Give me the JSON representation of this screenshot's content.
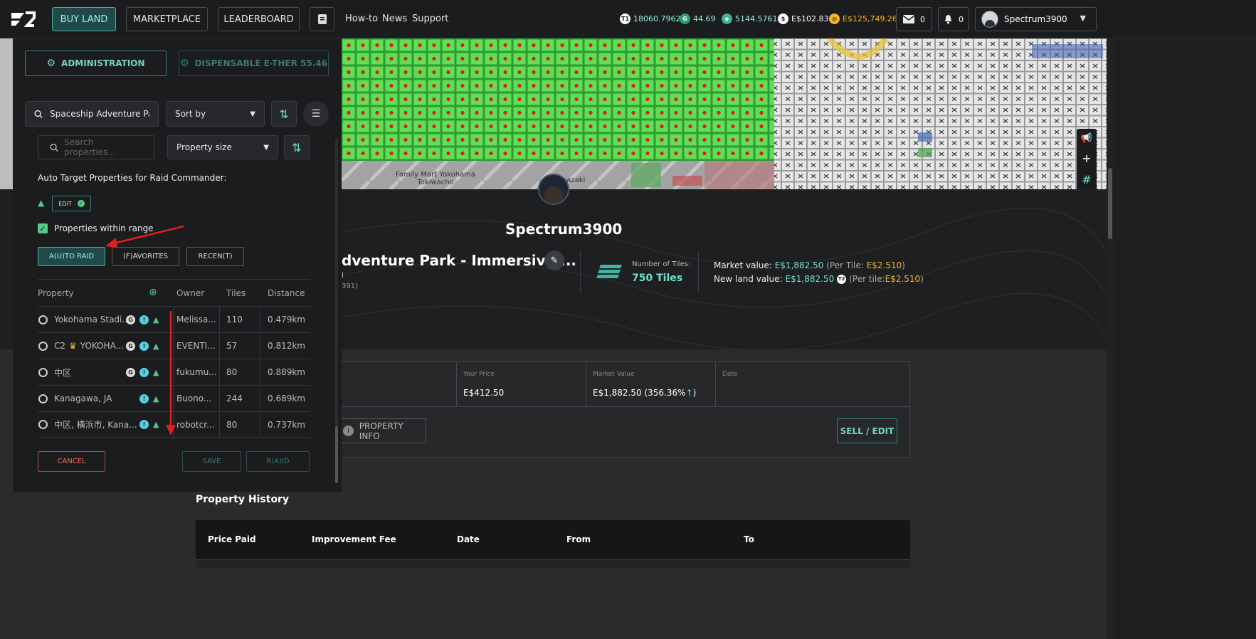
{
  "nav": {
    "buy_land": "BUY LAND",
    "marketplace": "MARKETPLACE",
    "leaderboard": "LEADERBOARD",
    "howto": "How-to",
    "news": "News",
    "support": "Support",
    "stats": {
      "t1": "18060.7962",
      "gem": "44.69",
      "essence": "5144.5761",
      "dollar": "E$102.83",
      "gold": "E$125,749.26"
    },
    "mail_count": "0",
    "notif_count": "0",
    "username": "Spectrum3900"
  },
  "map": {
    "label_familymart": "Family Mart Yokohama\nTokiwacho",
    "label_partial": "nazaki"
  },
  "profile": {
    "name": "Spectrum3900",
    "property_title": "dventure Park - Immersive ...",
    "subtitle_partial": "i",
    "id_partial": "391)",
    "tiles_label": "Number of Tiles:",
    "tiles_value": "750 Tiles",
    "market_value_label": "Market value:",
    "market_value": "E$1,882.50",
    "market_per_tile_prefix": "(Per Tile: ",
    "market_per_tile": "E$2.510",
    "new_land_label": "New land value:",
    "new_land_value": "E$1,882.50",
    "new_land_per_tile_prefix": "(Per tile: ",
    "new_land_per_tile": "E$2.510"
  },
  "details": {
    "your_price_label": "Your Price",
    "your_price": "E$412.50",
    "market_value_label": "Market Value",
    "market_value": "E$1,882.50 (356.36%",
    "date_label": "Date",
    "property_info": "PROPERTY INFO",
    "sell_edit": "SELL / EDIT"
  },
  "history": {
    "title": "Property History",
    "columns": [
      "Price Paid",
      "Improvement Fee",
      "Date",
      "From",
      "To"
    ]
  },
  "panel": {
    "administration": "ADMINISTRATION",
    "dispensable": "DISPENSABLE E-THER 55.46",
    "search_value": "Spaceship Adventure Par",
    "sort_by": "Sort by",
    "search_placeholder": "Search properties...",
    "property_size": "Property size",
    "auto_target_label": "Auto Target Properties for Raid Commander:",
    "edit": "EDIT",
    "within_range": "Properties within range",
    "tab_auto": "A(U)TO RAID",
    "tab_fav": "(F)AVORITES",
    "tab_recent": "RECEN(T)",
    "col_property": "Property",
    "col_owner": "Owner",
    "col_tiles": "Tiles",
    "col_distance": "Distance",
    "rows": [
      {
        "name": "Yokohama Stadi...",
        "owner": "Melissa...",
        "tiles": "110",
        "distance": "0.479km"
      },
      {
        "name": "C2",
        "name2": "YOKOHA...",
        "owner": "EVENTI...",
        "tiles": "57",
        "distance": "0.812km"
      },
      {
        "name": "中区",
        "owner": "fukumu...",
        "tiles": "80",
        "distance": "0.889km"
      },
      {
        "name": "Kanagawa, JA",
        "owner": "Buono...",
        "tiles": "244",
        "distance": "0.689km"
      },
      {
        "name": "中区, 横浜市, Kana...",
        "owner": "robotcr...",
        "tiles": "80",
        "distance": "0.737km"
      }
    ],
    "cancel": "CANCEL",
    "save": "SAVE",
    "raid": "R(A)ID"
  },
  "colors": {
    "accent": "#3fb3a4",
    "green_tile": "#5ed84e",
    "red_arrow": "#e02020",
    "gold": "#f5b52a"
  }
}
